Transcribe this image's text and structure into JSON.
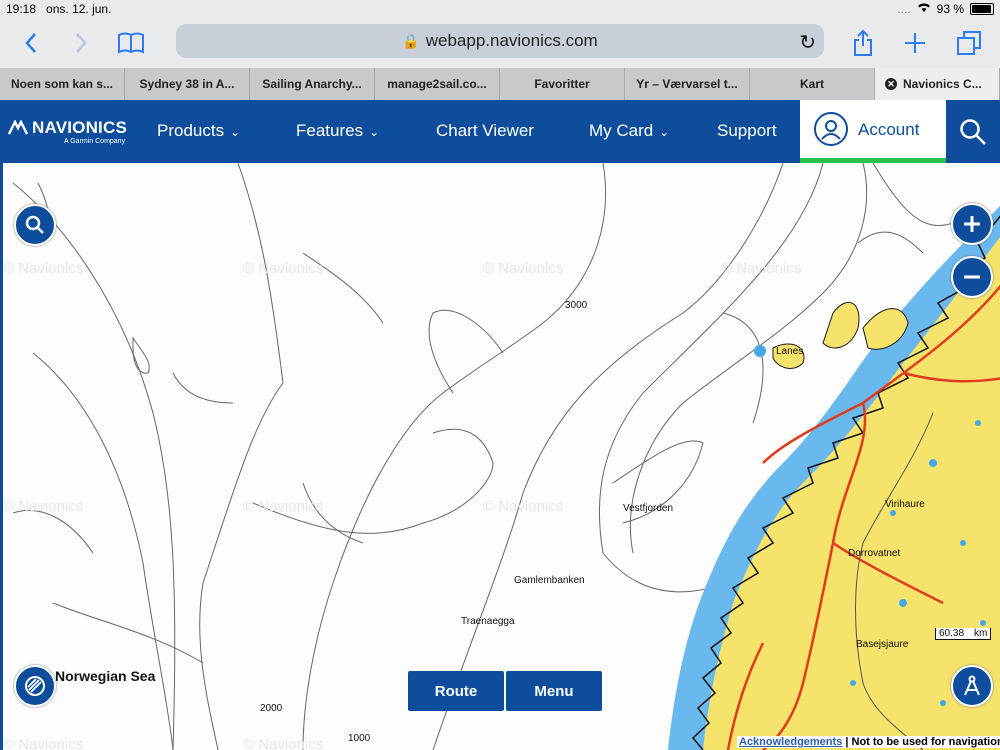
{
  "status_bar": {
    "time": "19:18",
    "date": "ons. 12. jun.",
    "battery": "93 %",
    "battery_level": 0.93,
    "signal": "....",
    "wifi": "wifi-icon"
  },
  "browser": {
    "url": "webapp.navionics.com",
    "tabs": [
      {
        "label": "Noen som kan s..."
      },
      {
        "label": "Sydney 38 in A..."
      },
      {
        "label": "Sailing Anarchy..."
      },
      {
        "label": "manage2sail.co..."
      },
      {
        "label": "Favoritter"
      },
      {
        "label": "Yr – Værvarsel t..."
      },
      {
        "label": "Kart"
      },
      {
        "label": "Navionics C...",
        "active": true
      }
    ]
  },
  "site_nav": {
    "logo": "NAVIONICS",
    "logo_sub": "A Garmin Company",
    "products": "Products",
    "features": "Features",
    "chart_viewer": "Chart Viewer",
    "my_card": "My Card",
    "support": "Support",
    "account": "Account"
  },
  "map": {
    "watermark": "© Navionics",
    "sea_name": "Norwegian Sea",
    "labels": [
      "3000",
      "Lanes",
      "Vestfjorden",
      "Virihaure",
      "Dorrovatnet",
      "Gamlembanken",
      "Traenaegga",
      "Basejsjaure",
      "2000",
      "1000"
    ],
    "route_button": "Route",
    "menu_button": "Menu",
    "scale_value": "60.38",
    "scale_unit": "km",
    "acknowledgements": "Acknowledgements",
    "disclaimer": "| Not to be used for navigation",
    "colors": {
      "land": "#f6e36b",
      "shallow": "#44a8e8",
      "roads": "#e23a1a",
      "nav_blue": "#0d4d9c"
    }
  }
}
